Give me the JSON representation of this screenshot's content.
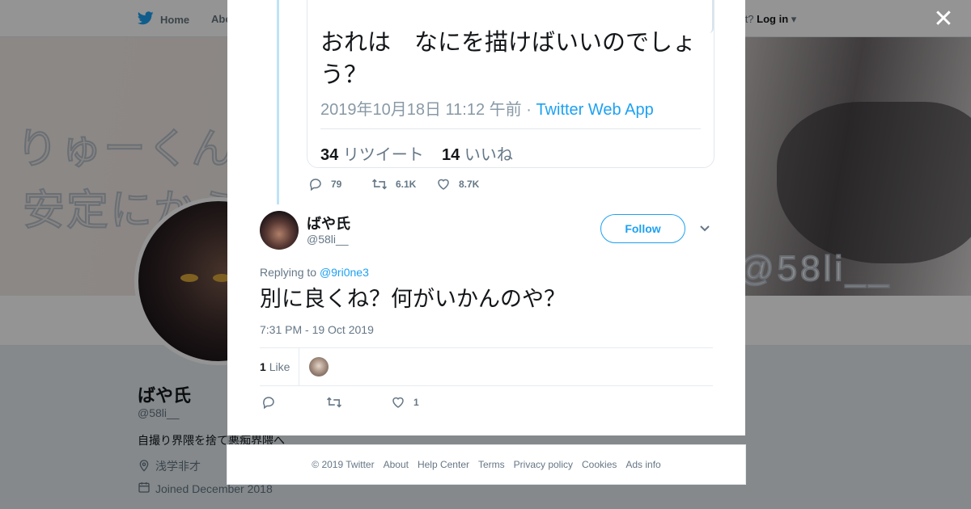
{
  "topbar": {
    "home_label": "Home",
    "about_label": "Abo",
    "account_prompt": "ccount?",
    "login_label": "Log in"
  },
  "banner": {
    "art_line1": "りゅーくんの",
    "art_line2": "安定にから",
    "art_handle": "@58li__"
  },
  "profile": {
    "name": "ばや氏",
    "handle": "@58li__",
    "bio": "自撮り界隈を捨て悪痴界隈へ",
    "location": "浅学非才",
    "joined": "Joined December 2018"
  },
  "quoted_tweet": {
    "text": "おれは　なにを描けばいいのでしょう？",
    "timestamp": "2019年10月18日 11:12 午前 · ",
    "source": "Twitter Web App",
    "retweets_count": "34",
    "retweets_label": "リツイート",
    "likes_count": "14",
    "likes_label": "いいね"
  },
  "parent_actions": {
    "replies": "79",
    "retweets": "6.1K",
    "likes": "8.7K"
  },
  "reply": {
    "name": "ばや氏",
    "handle": "@58li__",
    "follow_label": "Follow",
    "replying_prefix": "Replying to ",
    "replying_to": "@9ri0ne3",
    "text": "別に良くね？何がいかんのや？",
    "time": "7:31 PM - 19 Oct 2019",
    "likes_count": "1",
    "likes_label": "Like",
    "action_likes": "1"
  },
  "footer": {
    "copyright": "© 2019 Twitter",
    "links": [
      "About",
      "Help Center",
      "Terms",
      "Privacy policy",
      "Cookies",
      "Ads info"
    ]
  },
  "colors": {
    "accent": "#1da1f2",
    "thread_line": "#bfe3f7",
    "muted_text": "#657786"
  },
  "icons": {
    "logo": "twitter-bird-icon",
    "close": "close-icon",
    "reply": "reply-icon",
    "retweet": "retweet-icon",
    "like": "heart-icon",
    "caret": "chevron-down-icon",
    "location": "location-pin-icon",
    "calendar": "calendar-icon"
  }
}
